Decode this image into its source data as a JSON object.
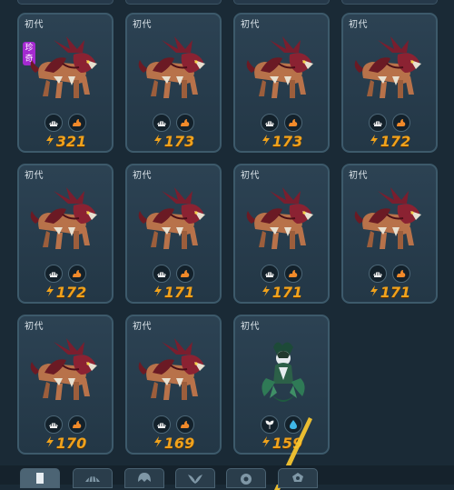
{
  "cards": [
    {
      "badge": "初代",
      "power": "321",
      "rare": "珍奇",
      "creature": "beast",
      "icons": [
        "shell-icon",
        "flame-icon"
      ]
    },
    {
      "badge": "初代",
      "power": "173",
      "creature": "beast",
      "icons": [
        "shell-icon",
        "flame-icon"
      ]
    },
    {
      "badge": "初代",
      "power": "173",
      "creature": "beast",
      "icons": [
        "shell-icon",
        "flame-icon"
      ]
    },
    {
      "badge": "初代",
      "power": "172",
      "creature": "beast",
      "icons": [
        "shell-icon",
        "flame-icon"
      ]
    },
    {
      "badge": "初代",
      "power": "172",
      "creature": "beast",
      "icons": [
        "shell-icon",
        "flame-icon"
      ]
    },
    {
      "badge": "初代",
      "power": "171",
      "creature": "beast",
      "icons": [
        "shell-icon",
        "flame-icon"
      ]
    },
    {
      "badge": "初代",
      "power": "171",
      "creature": "beast",
      "icons": [
        "shell-icon",
        "flame-icon"
      ]
    },
    {
      "badge": "初代",
      "power": "171",
      "creature": "beast",
      "icons": [
        "shell-icon",
        "flame-icon"
      ]
    },
    {
      "badge": "初代",
      "power": "170",
      "creature": "beast",
      "icons": [
        "shell-icon",
        "flame-icon"
      ]
    },
    {
      "badge": "初代",
      "power": "169",
      "creature": "beast",
      "icons": [
        "shell-icon",
        "flame-icon"
      ]
    },
    {
      "badge": "初代",
      "power": "159",
      "creature": "plant",
      "icons": [
        "leaf-icon",
        "water-drop-icon"
      ]
    }
  ],
  "tabs": [
    {
      "icon": "list-icon",
      "active": true
    },
    {
      "icon": "shell-icon",
      "active": false
    },
    {
      "icon": "helmet-icon",
      "active": false
    },
    {
      "icon": "wing-icon",
      "active": false
    },
    {
      "icon": "orb-icon",
      "active": false
    },
    {
      "icon": "emblem-icon",
      "active": false
    }
  ],
  "colors": {
    "background": "#1a2a36",
    "card": "#2a3f50",
    "border": "#3d5a6b",
    "power": "#f0a21c",
    "rare": "#a42ad0"
  }
}
